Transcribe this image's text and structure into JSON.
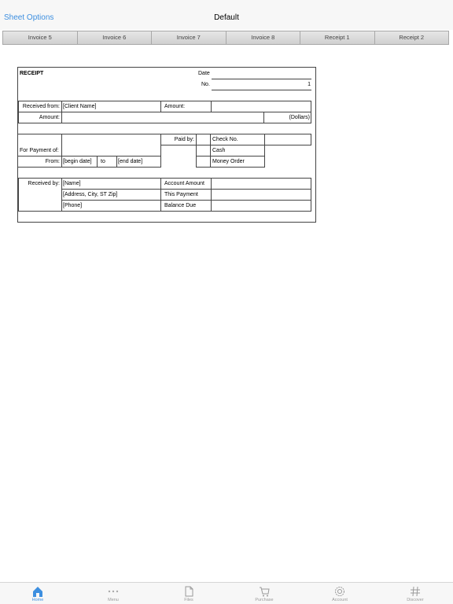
{
  "header": {
    "sheet_options": "Sheet Options",
    "title": "Default"
  },
  "tabs": [
    "Invoice 5",
    "Invoice 6",
    "Invoice 7",
    "Invoice 8",
    "Receipt 1",
    "Receipt 2"
  ],
  "receipt": {
    "heading": "RECEIPT",
    "date_label": "Date",
    "no_label": "No.",
    "no_value": "1",
    "received_from_label": "Received from:",
    "client_name": "[Client Name]",
    "amount_label_right": "Amount:",
    "amount_label": "Amount:",
    "dollars": "(Dollars)",
    "paid_by_label": "Paid by:",
    "check_no": "Check No.",
    "cash": "Cash",
    "money_order": "Money Order",
    "for_payment_label": "For Payment of:",
    "from_label": "From:",
    "begin_date": "[begin date]",
    "to": "to",
    "end_date": "[end date]",
    "received_by_label": "Received by:",
    "name": "[Name]",
    "address": "[Address, City, ST  Zip]",
    "phone": "[Phone]",
    "account_amount": "Account Amount",
    "this_payment": "This Payment",
    "balance_due": "Balance Due"
  },
  "bottom_nav": [
    {
      "label": "Home",
      "icon": "home-icon",
      "active": true
    },
    {
      "label": "Menu",
      "icon": "more-icon"
    },
    {
      "label": "Files",
      "icon": "file-icon"
    },
    {
      "label": "Purchase",
      "icon": "cart-icon"
    },
    {
      "label": "Account",
      "icon": "gear-icon"
    },
    {
      "label": "Discover",
      "icon": "hash-icon"
    }
  ],
  "colors": {
    "accent": "#3d8fe0",
    "tab_bg": "#d0d0d0",
    "bar_bg": "#f7f7f7"
  }
}
